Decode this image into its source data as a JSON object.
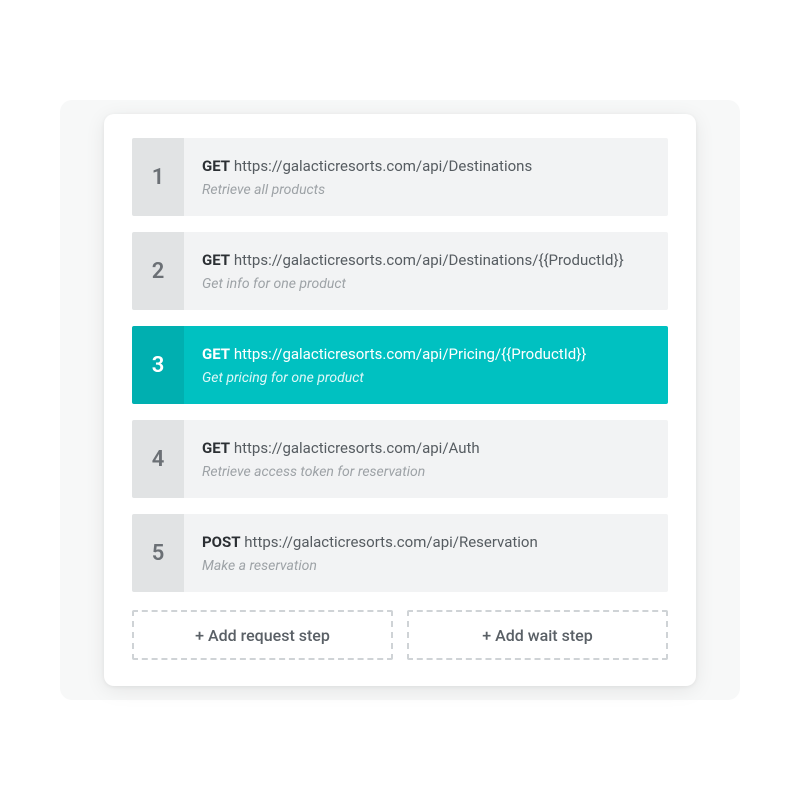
{
  "steps": [
    {
      "number": "1",
      "method": "GET",
      "url": "https://galacticresorts.com/api/Destinations",
      "description": "Retrieve all products",
      "active": false
    },
    {
      "number": "2",
      "method": "GET",
      "url": "https://galacticresorts.com/api/Destinations/{{ProductId}}",
      "description": "Get info for one product",
      "active": false
    },
    {
      "number": "3",
      "method": "GET",
      "url": "https://galacticresorts.com/api/Pricing/{{ProductId}}",
      "description": "Get pricing for one product",
      "active": true
    },
    {
      "number": "4",
      "method": "GET",
      "url": "https://galacticresorts.com/api/Auth",
      "description": "Retrieve access token for reservation",
      "active": false
    },
    {
      "number": "5",
      "method": "POST",
      "url": "https://galacticresorts.com/api/Reservation",
      "description": "Make a reservation",
      "active": false
    }
  ],
  "buttons": {
    "add_request_label": "+ Add request step",
    "add_wait_label": "+ Add wait step"
  },
  "colors": {
    "accent": "#00c1c1",
    "accent_dark": "#00afb0"
  }
}
